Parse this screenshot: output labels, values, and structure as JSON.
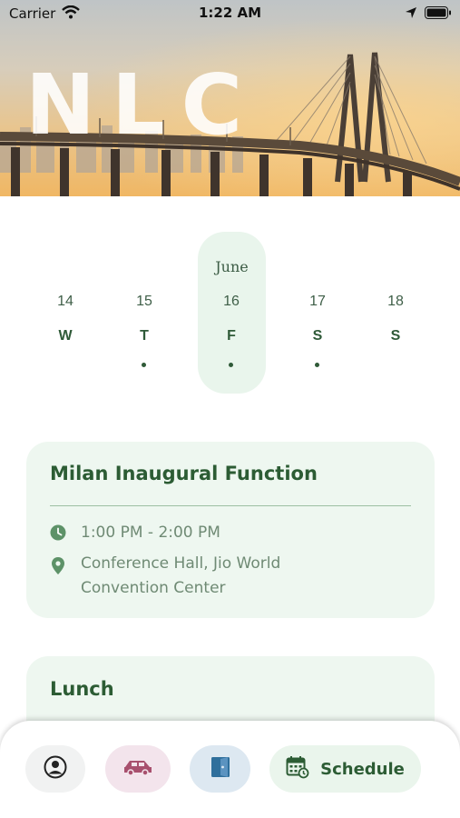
{
  "status_bar": {
    "carrier": "Carrier",
    "time": "1:22 AM"
  },
  "header": {
    "logo_text": "NLC"
  },
  "calendar": {
    "month": "June",
    "days": [
      {
        "date": "14",
        "weekday": "W",
        "has_event": false,
        "selected": false
      },
      {
        "date": "15",
        "weekday": "T",
        "has_event": true,
        "selected": false
      },
      {
        "date": "16",
        "weekday": "F",
        "has_event": true,
        "selected": true
      },
      {
        "date": "17",
        "weekday": "S",
        "has_event": true,
        "selected": false
      },
      {
        "date": "18",
        "weekday": "S",
        "has_event": false,
        "selected": false
      }
    ]
  },
  "events": [
    {
      "title": "Milan Inaugural Function",
      "time": "1:00 PM - 2:00 PM",
      "location_line1": "Conference Hall, Jio World",
      "location_line2": "Convention Center"
    },
    {
      "title": "Lunch"
    }
  ],
  "bottom_nav": {
    "items": [
      {
        "icon": "profile-icon",
        "label": ""
      },
      {
        "icon": "car-icon",
        "label": ""
      },
      {
        "icon": "door-icon",
        "label": ""
      },
      {
        "icon": "calendar-icon",
        "label": "Schedule"
      }
    ]
  },
  "colors": {
    "accent_green": "#2c5c34",
    "card_bg": "#eef7f0",
    "highlight_bg": "#e9f5ec"
  }
}
